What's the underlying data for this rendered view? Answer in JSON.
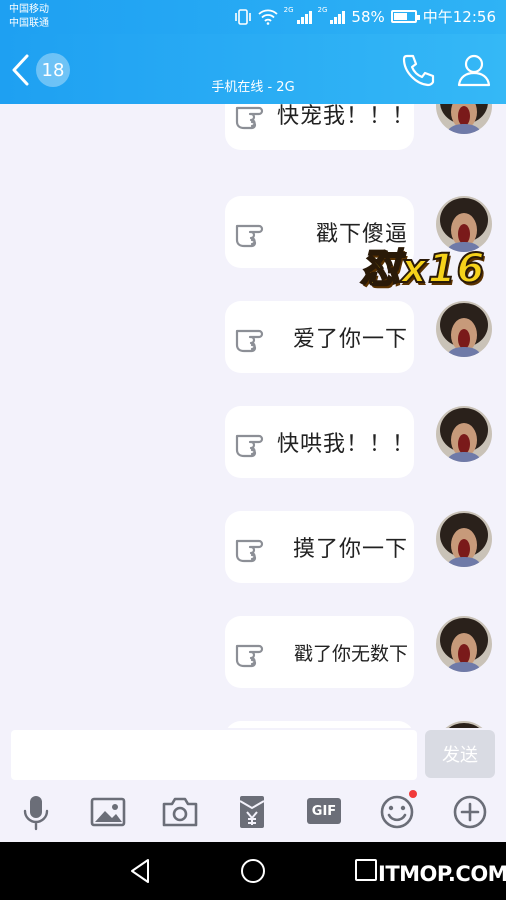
{
  "status_bar": {
    "carrier_1": "中国移动",
    "carrier_2": "中国联通",
    "net_1": "2G",
    "net_2": "2G",
    "battery": "58%",
    "battery_level": 0.58,
    "time": "中午12:56"
  },
  "header": {
    "unread_count": "18",
    "subtitle": "手机在线 - 2G",
    "icons": [
      "back-chevron-icon",
      "phone-icon",
      "profile-icon"
    ]
  },
  "messages": [
    {
      "text": "快宠我！！！"
    },
    {
      "text": "戳下傻逼"
    },
    {
      "text": "爱了你一下"
    },
    {
      "text": "快哄我！！！"
    },
    {
      "text": "摸了你一下"
    },
    {
      "text": "戳了你无数下"
    },
    {
      "text": ""
    }
  ],
  "combo_badge": "怼x16",
  "input_bar": {
    "placeholder": "",
    "send_label": "发送"
  },
  "toolbar": {
    "icons": [
      "microphone-icon",
      "image-icon",
      "camera-icon",
      "red-packet-icon",
      "gif-icon",
      "emoji-icon",
      "plus-icon"
    ],
    "gif_label": "GIF"
  },
  "watermark": "ITMOP.COM",
  "colors": {
    "header_blue": "#1ea0f2",
    "chat_background": "#f3f2fb",
    "bubble": "#ffffff",
    "icon_gray": "#6b6e78",
    "notification_red": "#f13a3a"
  }
}
